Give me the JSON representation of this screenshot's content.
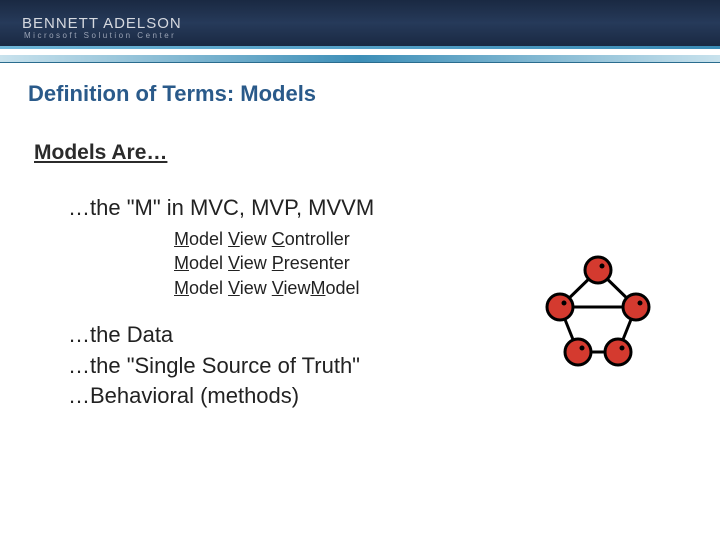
{
  "logo": {
    "brand": "BENNETT ADELSON",
    "sub": "Microsoft Solution Center"
  },
  "title": "Definition of Terms: Models",
  "subhead": "Models Are…",
  "b_m": "…the \"M\" in MVC, MVP, MVVM",
  "exp": {
    "l1": {
      "m": "M",
      "mr": "odel ",
      "v": "V",
      "vr": "iew ",
      "c": "C",
      "cr": "ontroller"
    },
    "l2": {
      "m": "M",
      "mr": "odel ",
      "v": "V",
      "vr": "iew ",
      "p": "P",
      "pr": "resenter"
    },
    "l3": {
      "m": "M",
      "mr": "odel ",
      "v": "V",
      "vr": "iew ",
      "vm1": "V",
      "vm1r": "iew",
      "vm2": "M",
      "vm2r": "odel"
    }
  },
  "b2": "…the Data",
  "b3": "…the \"Single Source of Truth\"",
  "b4": "…Behavioral (methods)"
}
